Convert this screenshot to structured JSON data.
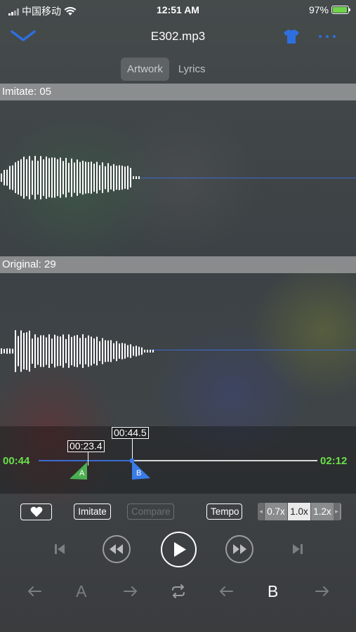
{
  "status_bar": {
    "carrier": "中国移动",
    "time": "12:51 AM",
    "battery_percent": "97%",
    "battery_level": 0.97
  },
  "nav": {
    "title": "E302.mp3",
    "tabs": [
      {
        "label": "Artwork",
        "active": true
      },
      {
        "label": "Lyrics",
        "active": false
      }
    ]
  },
  "tracks": {
    "imitate_label": "Imitate: 05",
    "original_label": "Original: 29"
  },
  "timeline": {
    "start_time": "00:44",
    "end_time": "02:12",
    "marker_a_time": "00:23.4",
    "marker_a_label": "A",
    "marker_b_time": "00:44.5",
    "marker_b_label": "B"
  },
  "buttons": {
    "imitate": "Imitate",
    "compare": "Compare",
    "tempo": "Tempo"
  },
  "speed_options": [
    "0.7x",
    "1.0x",
    "1.2x"
  ],
  "speed_selected": "1.0x",
  "ab_controls": {
    "a_label": "A",
    "b_label": "B"
  },
  "colors": {
    "accent_blue": "#2e6fe0",
    "time_green": "#6be04a",
    "marker_a_green": "#4caf50",
    "marker_b_blue": "#3a7be8"
  }
}
